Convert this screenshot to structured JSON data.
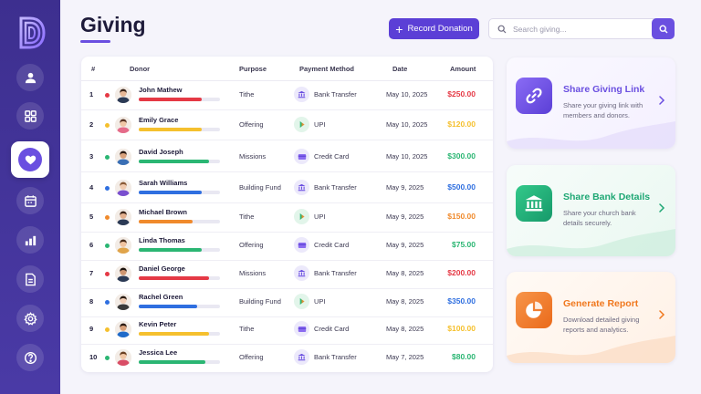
{
  "page": {
    "title": "Giving"
  },
  "header": {
    "record_button_label": "Record Donation",
    "search_placeholder": "Search giving..."
  },
  "sidebar": {
    "items": [
      {
        "name": "users",
        "icon": "user-icon"
      },
      {
        "name": "dashboard",
        "icon": "grid-icon"
      },
      {
        "name": "giving",
        "icon": "heart-icon",
        "active": true
      },
      {
        "name": "calendar",
        "icon": "calendar-icon"
      },
      {
        "name": "reports",
        "icon": "bar-chart-icon"
      },
      {
        "name": "documents",
        "icon": "document-icon"
      },
      {
        "name": "settings",
        "icon": "gear-icon"
      },
      {
        "name": "help",
        "icon": "help-icon"
      }
    ]
  },
  "table": {
    "columns": [
      "#",
      "Donor",
      "Purpose",
      "Payment Method",
      "Date",
      "Amount"
    ],
    "rows": [
      {
        "num": "1",
        "donor": "John Mathew",
        "purpose": "Tithe",
        "method": "Bank Transfer",
        "date": "May 10, 2025",
        "amount": "$250.00",
        "color": "#e53945",
        "progress": 0.77
      },
      {
        "num": "2",
        "donor": "Emily Grace",
        "purpose": "Offering",
        "method": "UPI",
        "date": "May 10, 2025",
        "amount": "$120.00",
        "color": "#f5c02e",
        "progress": 0.77
      },
      {
        "num": "3",
        "donor": "David Joseph",
        "purpose": "Missions",
        "method": "Credit Card",
        "date": "May 10, 2025",
        "amount": "$300.00",
        "color": "#2bb673",
        "progress": 0.86
      },
      {
        "num": "4",
        "donor": "Sarah Williams",
        "purpose": "Building Fund",
        "method": "Bank Transfer",
        "date": "May 9, 2025",
        "amount": "$500.00",
        "color": "#2f6fe0",
        "progress": 0.77
      },
      {
        "num": "5",
        "donor": "Michael Brown",
        "purpose": "Tithe",
        "method": "UPI",
        "date": "May 9, 2025",
        "amount": "$150.00",
        "color": "#f08a2c",
        "progress": 0.66
      },
      {
        "num": "6",
        "donor": "Linda Thomas",
        "purpose": "Offering",
        "method": "Credit Card",
        "date": "May 9, 2025",
        "amount": "$75.00",
        "color": "#2bb673",
        "progress": 0.77
      },
      {
        "num": "7",
        "donor": "Daniel George",
        "purpose": "Missions",
        "method": "Bank Transfer",
        "date": "May 8, 2025",
        "amount": "$200.00",
        "color": "#e53945",
        "progress": 0.86
      },
      {
        "num": "8",
        "donor": "Rachel Green",
        "purpose": "Building Fund",
        "method": "UPI",
        "date": "May 8, 2025",
        "amount": "$350.00",
        "color": "#2f6fe0",
        "progress": 0.72
      },
      {
        "num": "9",
        "donor": "Kevin Peter",
        "purpose": "Tithe",
        "method": "Credit Card",
        "date": "May 8, 2025",
        "amount": "$100.00",
        "color": "#f5c02e",
        "progress": 0.86
      },
      {
        "num": "10",
        "donor": "Jessica Lee",
        "purpose": "Offering",
        "method": "Bank Transfer",
        "date": "May 7, 2025",
        "amount": "$80.00",
        "color": "#2bb673",
        "progress": 0.82
      }
    ]
  },
  "actions": [
    {
      "title": "Share Giving Link",
      "desc": "Share your giving link with members and donors.",
      "icon": "link-icon",
      "accent": "#6a4fe0"
    },
    {
      "title": "Share Bank Details",
      "desc": "Share your church bank details securely.",
      "icon": "bank-icon",
      "accent": "#1ea774"
    },
    {
      "title": "Generate Report",
      "desc": "Download detailed giving reports and analytics.",
      "icon": "pie-chart-icon",
      "accent": "#f0781e"
    }
  ],
  "colors": {
    "sidebar": "#42339a",
    "accent": "#6a4fe0",
    "red": "#e53945",
    "orange": "#f08a2c",
    "green": "#2bb673",
    "blue": "#2f6fe0"
  }
}
